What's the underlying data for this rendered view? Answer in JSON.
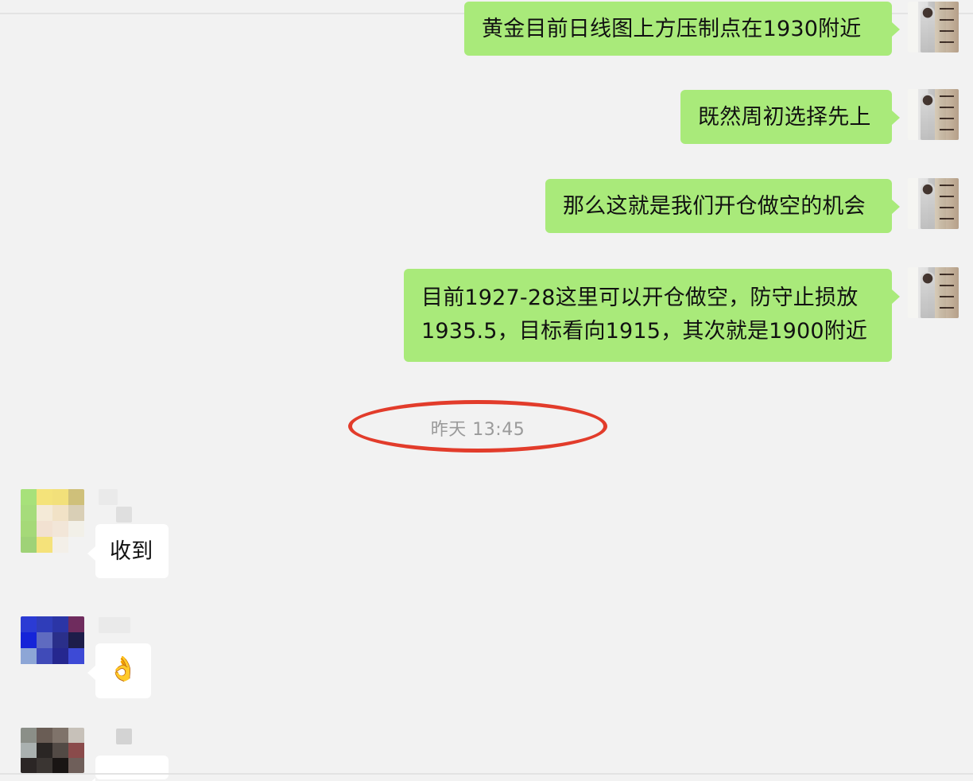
{
  "messages": {
    "m1": {
      "text": "黄金目前日线图上方压制点在1930附近"
    },
    "m2": {
      "text": "既然周初选择先上"
    },
    "m3": {
      "text": "那么这就是我们开仓做空的机会"
    },
    "m4": {
      "line1": "目前1927-28这里可以开仓做空，防守止损放",
      "line2": "1935.5，目标看向1915，其次就是1900附近"
    },
    "timestamp": "昨天 13:45",
    "left1": {
      "text": "收到"
    },
    "left2": {
      "emoji": "👌"
    }
  },
  "colors": {
    "background": "#f2f2f2",
    "bubble_green": "#a9ea7a",
    "bubble_white": "#ffffff",
    "highlight_circle": "#e23c2b",
    "timestamp_text": "#9a9a9a"
  },
  "icons": {
    "self_avatar": "self-avatar",
    "contact_avatar": "contact-avatar",
    "ok_hand": "ok-hand-emoji"
  }
}
